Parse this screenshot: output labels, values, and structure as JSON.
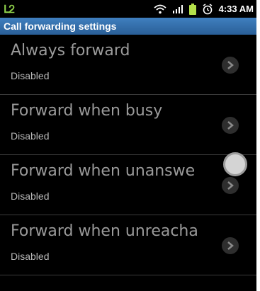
{
  "status_bar": {
    "left_indicator": "ᒪᒿ",
    "time": "4:33 AM",
    "icons": [
      "wifi-icon",
      "signal-icon",
      "battery-icon",
      "alarm-icon"
    ]
  },
  "title_bar": {
    "title": "Call forwarding settings"
  },
  "settings": [
    {
      "label": "Always forward",
      "status": "Disabled"
    },
    {
      "label": "Forward when busy",
      "status": "Disabled"
    },
    {
      "label": "Forward when unanswe",
      "status": "Disabled"
    },
    {
      "label": "Forward when unreacha",
      "status": "Disabled"
    }
  ],
  "colors": {
    "title_bar": "#2f6aa8",
    "background": "#000000",
    "label": "#9a9a9a",
    "subtext": "#b8b8b8"
  }
}
